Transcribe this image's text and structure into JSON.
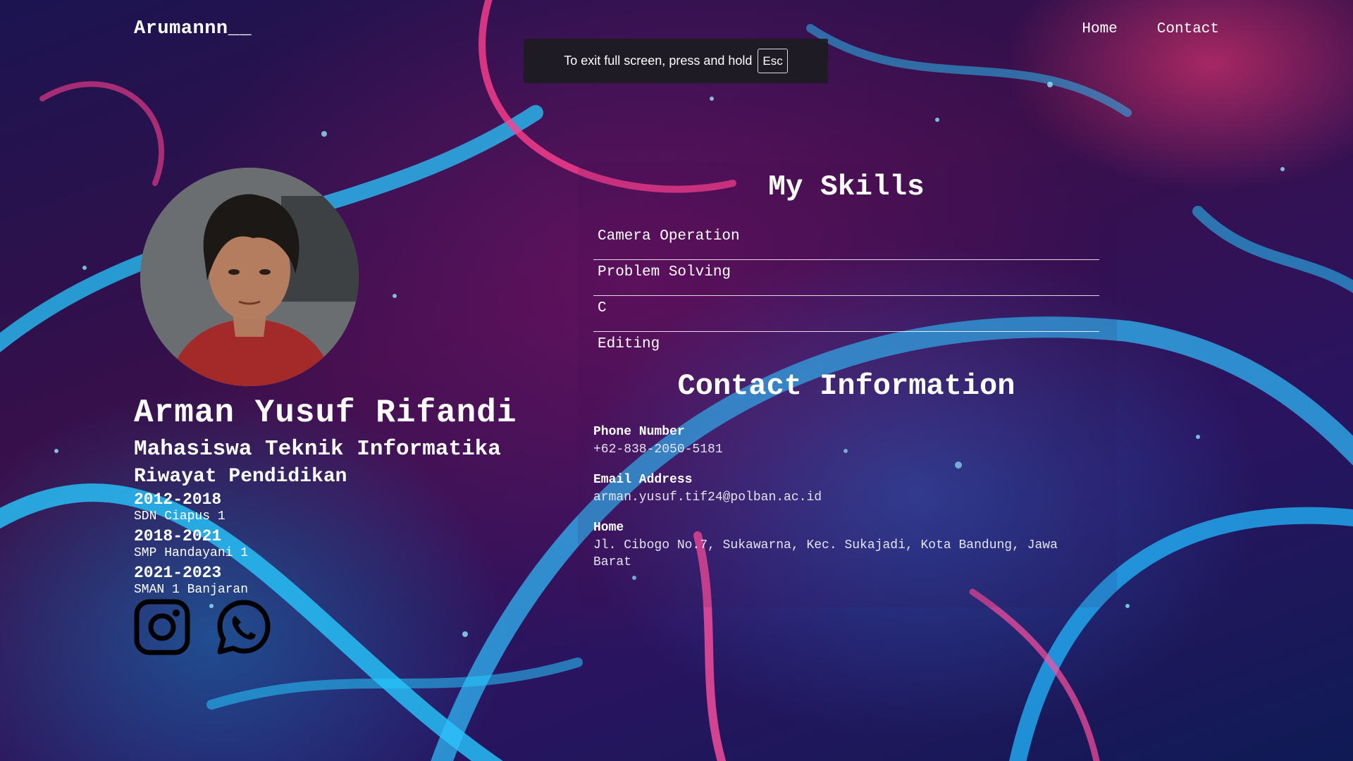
{
  "brand": "Arumannn__",
  "nav": {
    "home": "Home",
    "contact": "Contact"
  },
  "fullscreen_notice": {
    "text": "To exit full screen, press and hold",
    "key": "Esc"
  },
  "profile": {
    "name": "Arman Yusuf Rifandi",
    "role": "Mahasiswa Teknik Informatika",
    "education_heading": "Riwayat Pendidikan",
    "education": [
      {
        "years": "2012-2018",
        "school": "SDN Ciapus 1"
      },
      {
        "years": "2018-2021",
        "school": "SMP Handayani 1"
      },
      {
        "years": "2021-2023",
        "school": "SMAN 1 Banjaran"
      }
    ]
  },
  "socials": {
    "instagram_icon": "instagram-icon",
    "whatsapp_icon": "whatsapp-icon"
  },
  "skills": {
    "title": "My Skills",
    "items": [
      "Camera Operation",
      "Problem Solving",
      "C",
      "Editing"
    ]
  },
  "contact": {
    "title": "Contact Information",
    "phone_label": "Phone Number",
    "phone": "+62-838-2050-5181",
    "email_label": "Email Address",
    "email": "arman.yusuf.tif24@polban.ac.id",
    "home_label": "Home",
    "home": "Jl. Cibogo No.7, Sukawarna, Kec. Sukajadi, Kota Bandung, Jawa Barat"
  },
  "colors": {
    "neon_blue": "#27c8ff",
    "neon_pink": "#ff3f8f",
    "bg_dark": "#2a0f4a"
  }
}
